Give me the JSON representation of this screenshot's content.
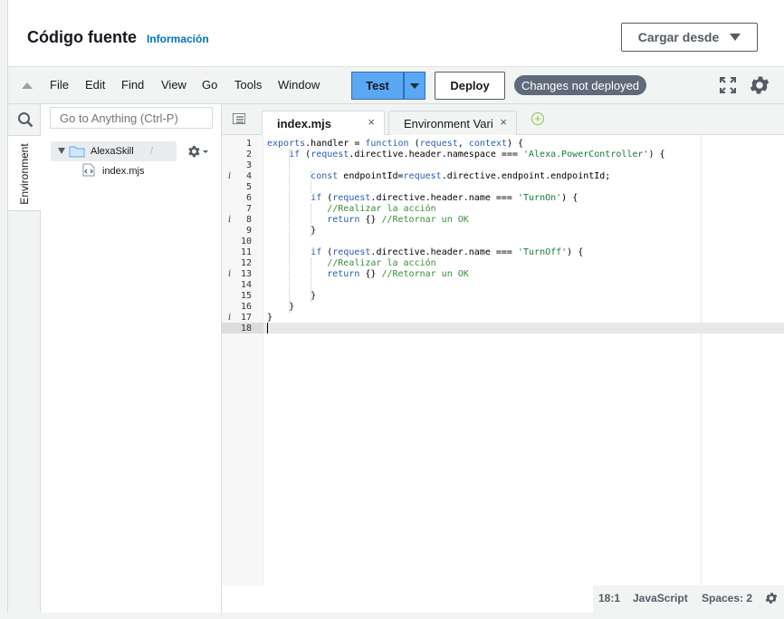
{
  "header": {
    "title": "Código fuente",
    "info_link": "Información",
    "load_button": "Cargar desde"
  },
  "toolbar": {
    "menu": [
      "File",
      "Edit",
      "Find",
      "View",
      "Go",
      "Tools",
      "Window"
    ],
    "test_button": "Test",
    "deploy_button": "Deploy",
    "status_badge": "Changes not deployed"
  },
  "rail": {
    "environment_tab": "Environment"
  },
  "tree": {
    "goto_placeholder": "Go to Anything (Ctrl-P)",
    "root_label": "AlexaSkill",
    "root_sep": "/",
    "file_label": "index.mjs"
  },
  "tabs": {
    "active_label": "index.mjs",
    "inactive_label": "Environment Vari",
    "close_glyph": "×",
    "add_glyph": "+"
  },
  "editor": {
    "line_numbers": [
      "1",
      "2",
      "3",
      "4",
      "5",
      "6",
      "7",
      "8",
      "9",
      "10",
      "11",
      "12",
      "13",
      "14",
      "15",
      "16",
      "17",
      "18"
    ],
    "info_lines": [
      4,
      8,
      13,
      17
    ],
    "code_lines": [
      "exports.handler = function (request, context) {",
      "    if (request.directive.header.namespace === 'Alexa.PowerController') {",
      "",
      "        const endpointId=request.directive.endpoint.endpointId;",
      "",
      "        if (request.directive.header.name === 'TurnOn') {",
      "           //Realizar la acción",
      "           return {} //Retornar un OK",
      "        }",
      "",
      "        if (request.directive.header.name === 'TurnOff') {",
      "           //Realizar la acción",
      "           return {} //Retornar un OK",
      "",
      "        }",
      "    }",
      "}",
      ""
    ]
  },
  "status": {
    "cursor_pos": "18:1",
    "language": "JavaScript",
    "indent": "Spaces: 2"
  },
  "colors": {
    "test_blue": "#5aa7f4",
    "badge_gray": "#5f6b7a",
    "link_blue": "#0073bb"
  }
}
